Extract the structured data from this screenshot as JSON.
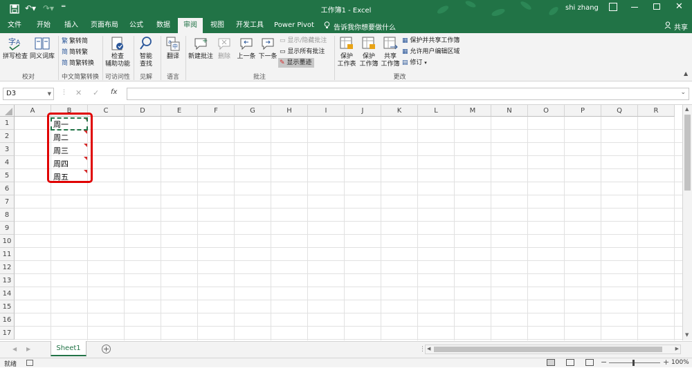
{
  "titlebar": {
    "doc_title": "工作簿1 - Excel",
    "user": "shi zhang"
  },
  "tabs": [
    "文件",
    "开始",
    "插入",
    "页面布局",
    "公式",
    "数据",
    "审阅",
    "视图",
    "开发工具",
    "Power Pivot"
  ],
  "active_tab": "审阅",
  "tell_me": "告诉我你想要做什么",
  "share": "共享",
  "ribbon": {
    "proofing": {
      "spell": "拼写检查",
      "thesaurus": "同义词库",
      "label": "校对"
    },
    "chinese": {
      "t2s": "繁转简",
      "s2t": "简转繁",
      "convert": "简繁转换",
      "label": "中文简繁转换"
    },
    "access": {
      "check_line1": "检查",
      "check_line2": "辅助功能",
      "label": "可访问性"
    },
    "insights": {
      "smart_line1": "智能",
      "smart_line2": "查找",
      "label": "见解"
    },
    "language": {
      "translate": "翻译",
      "label": "语言"
    },
    "comments": {
      "new": "新建批注",
      "delete": "删除",
      "prev": "上一条",
      "next": "下一条",
      "show_hide": "显示/隐藏批注",
      "show_all": "显示所有批注",
      "show_ink": "显示墨迹",
      "label": "批注"
    },
    "changes": {
      "protect_sheet_1": "保护",
      "protect_sheet_2": "工作表",
      "protect_wb_1": "保护",
      "protect_wb_2": "工作簿",
      "share_wb_1": "共享",
      "share_wb_2": "工作簿",
      "protect_share": "保护并共享工作簿",
      "allow_edit": "允许用户编辑区域",
      "track": "修订",
      "label": "更改"
    }
  },
  "formula": {
    "namebox": "D3",
    "fx": "fx",
    "value": ""
  },
  "columns": [
    "A",
    "B",
    "C",
    "D",
    "E",
    "F",
    "G",
    "H",
    "I",
    "J",
    "K",
    "L",
    "M",
    "N",
    "O",
    "P",
    "Q",
    "R"
  ],
  "rows": [
    "1",
    "2",
    "3",
    "4",
    "5",
    "6",
    "7",
    "8",
    "9",
    "10",
    "11",
    "12",
    "13",
    "14",
    "15",
    "16",
    "17"
  ],
  "cells": {
    "B1": "周一",
    "B2": "周二",
    "B3": "周三",
    "B4": "周四",
    "B5": "周五"
  },
  "sheets": {
    "active": "Sheet1"
  },
  "status": {
    "ready": "就绪",
    "zoom": "100%"
  },
  "colors": {
    "excel_green": "#217346",
    "highlight_red": "#e00000",
    "comment_red": "#d62a2a"
  }
}
